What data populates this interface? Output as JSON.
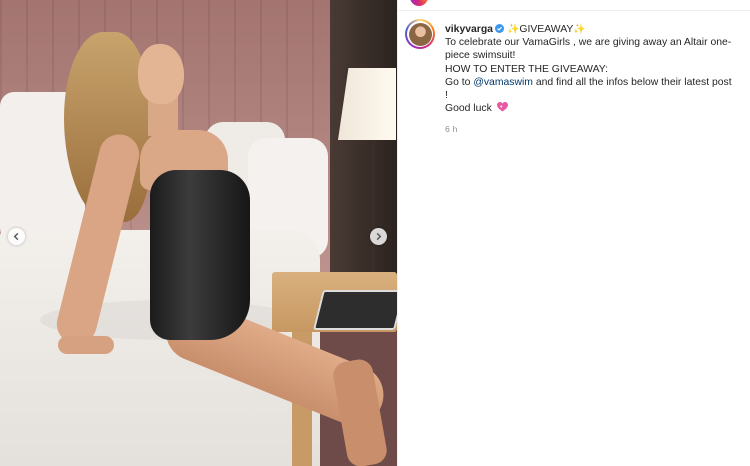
{
  "post": {
    "username": "vikyvarga",
    "caption_line1_after_badge": "GIVEAWAY",
    "caption_intro": "To celebrate our VamaGirls , we are giving away an Altair one-piece swimsuit!",
    "caption_how_to": "HOW TO ENTER THE GIVEAWAY:",
    "caption_goto": "Go to ",
    "mention": "@vamaswim",
    "caption_after_mention": " and find all the infos below their latest post",
    "caption_exclaim": "!",
    "caption_goodluck": "Good luck ",
    "time": "6 h"
  },
  "icons": {
    "verified": "verified-badge-icon",
    "sparkles": "sparkles-emoji",
    "heart": "sparkling-heart-emoji",
    "prev": "chevron-left-icon",
    "next": "chevron-right-icon"
  },
  "colors": {
    "verified": "#3897f0",
    "mention": "#00376b",
    "heart": "#e85aa3",
    "sparkle": "#f5b400"
  }
}
